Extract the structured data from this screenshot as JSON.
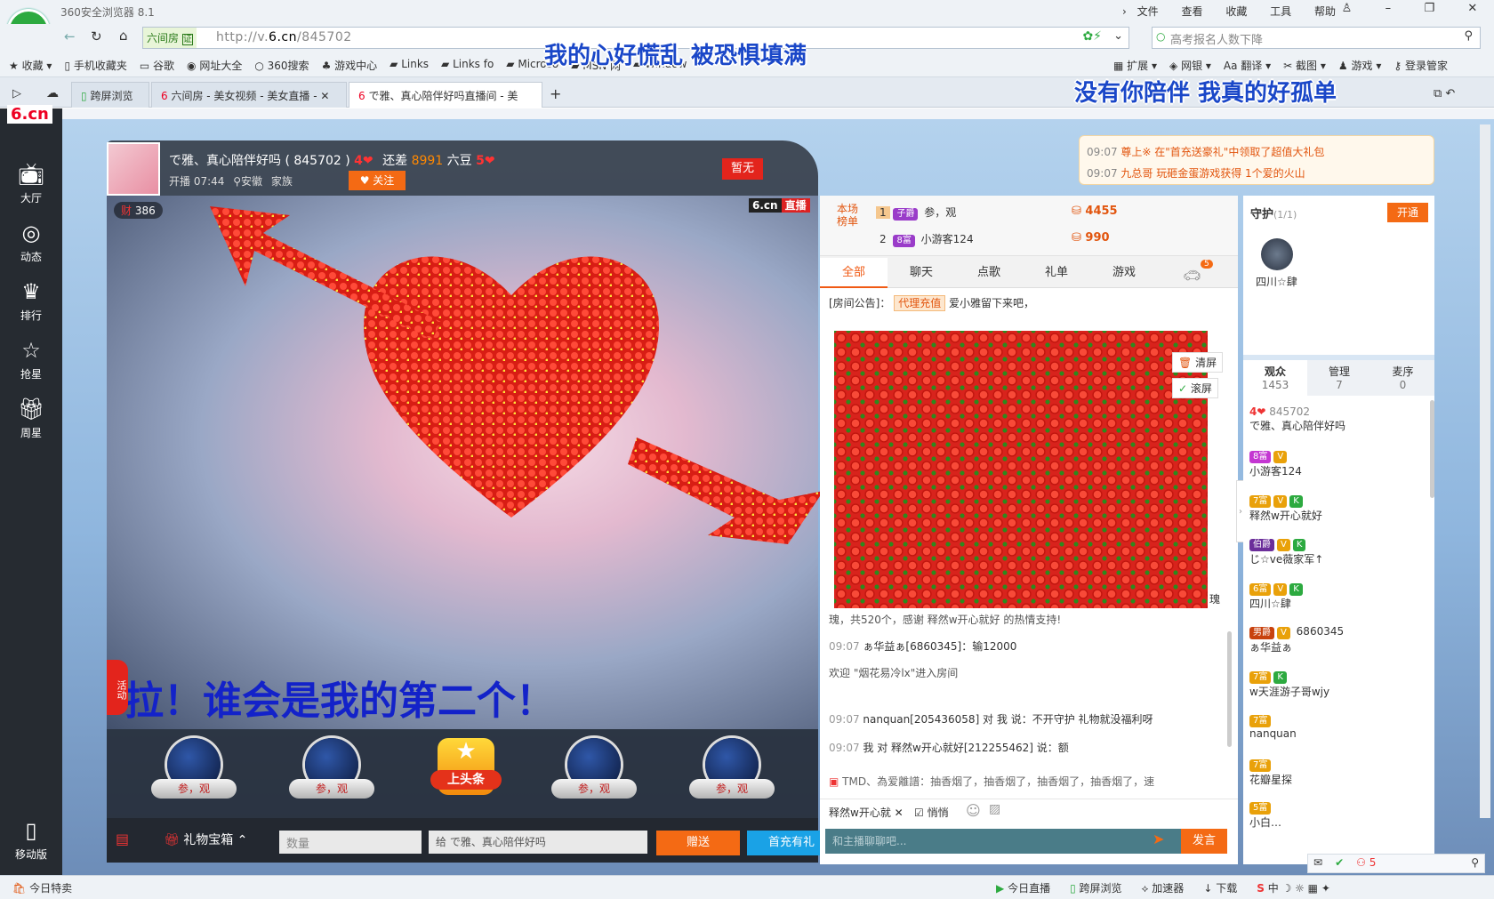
{
  "browser": {
    "title": "360安全浏览器 8.1",
    "menu": [
      "文件",
      "查看",
      "收藏",
      "工具",
      "帮助"
    ],
    "address_site": "六间房",
    "address_cert": "证",
    "url_prefix": "http://v.",
    "url_domain": "6.cn",
    "url_path": "/845702",
    "search_placeholder": "高考报名人数下降",
    "bookmarks": [
      "收藏",
      "手机收藏夹",
      "谷歌",
      "网址大全",
      "360搜索",
      "游戏中心",
      "Links",
      "Links fo",
      "Microso",
      "MSN 网",
      "Window"
    ],
    "tools": [
      "扩展",
      "网银",
      "翻译",
      "截图",
      "游戏",
      "登录管家"
    ],
    "tabs": [
      "跨屏浏览",
      "六间房 - 美女视频 - 美女直播 -",
      "で雅、真心陪伴好吗直播间 - 美"
    ]
  },
  "overlay": {
    "lyric1": "我的心好慌乱 被恐惧填满",
    "lyric2": "没有你陪伴 我真的好孤单",
    "video_caption": "拉！谁会是我的第二个！"
  },
  "sidebar": {
    "items": [
      "大厅",
      "动态",
      "排行",
      "抢星",
      "周星"
    ],
    "mobile": "移动版"
  },
  "site": {
    "logo": "6.cn"
  },
  "anchor": {
    "name_line": "で雅、真心陪伴好吗 ( 845702 )",
    "level": "4",
    "need_label": "还差",
    "need_value": "8991",
    "need_unit": "六豆",
    "next_level": "5",
    "open_time": "开播 07:44",
    "location": "安徽",
    "family": "家族",
    "follow": "关注",
    "flag": "暂无",
    "wealth": "386",
    "live_brand": "6.cn",
    "live_tag": "直播",
    "activity": "活动"
  },
  "notices": [
    {
      "time": "09:07",
      "text": "尊上※ 在\"首充送豪礼\"中领取了超值大礼包"
    },
    {
      "time": "09:07",
      "text": "九总哥 玩砸金蛋游戏获得 1个爱的火山"
    }
  ],
  "ranking": {
    "label": "本场榜单",
    "rows": [
      {
        "rank": "1",
        "badge": "子爵",
        "name": "参，观",
        "score": "4455"
      },
      {
        "rank": "2",
        "badge": "8富",
        "name": "小游客124",
        "score": "990"
      }
    ]
  },
  "chat_tabs": [
    "全部",
    "聊天",
    "点歌",
    "礼单",
    "游戏"
  ],
  "chat_tab_badge": "5",
  "chat": {
    "announce_label": "[房间公告]：",
    "announce_tag": "代理充值",
    "announce_text": "爱小雅留下来吧，",
    "clear_btn": "清屏",
    "scroll_btn": "滚屏",
    "gift_tail": "瑰",
    "gift_line": "瑰，共520个，感谢 释然w开心就好 的热情支持!",
    "messages": [
      {
        "time": "09:07",
        "text": "ぁ华益ぁ[6860345]：输12000"
      },
      {
        "time": "",
        "text": "欢迎 \"烟花易冷lx\"进入房间"
      },
      {
        "time": "09:07",
        "text": "nanquan[205436058] 对 我 说：不开守护 礼物就没福利呀"
      },
      {
        "time": "09:07",
        "text": "我 对 释然w开心就好[212255462] 说：额"
      },
      {
        "time": "",
        "text": "TMD、為爱離譜：抽香烟了，抽香烟了，抽香烟了，抽香烟了，速"
      }
    ],
    "target_user": "释然w开心就",
    "whisper": "悄悄",
    "input_placeholder": "和主播聊聊吧...",
    "send": "发言"
  },
  "gift_bar": {
    "items": [
      "参，观",
      "参，观",
      "上头条",
      "参，观",
      "参，观"
    ],
    "gift_box": "礼物宝箱",
    "qty_placeholder": "数量",
    "to_label": "给",
    "to_name": "で雅、真心陪伴好吗",
    "give": "赠送",
    "first_recharge": "首充有礼"
  },
  "guard": {
    "title": "守护",
    "count": "(1/1)",
    "open": "开通",
    "member": "四川☆肆"
  },
  "users": {
    "tabs": [
      {
        "label": "观众",
        "count": "1453"
      },
      {
        "label": "管理",
        "count": "7"
      },
      {
        "label": "麦序",
        "count": "0"
      }
    ],
    "list": [
      {
        "badge": "4",
        "id": "845702",
        "name": "で雅、真心陪伴好吗"
      },
      {
        "badge": "8富",
        "id": "",
        "name": "小游客124"
      },
      {
        "badge": "7富",
        "id": "",
        "name": "释然w开心就好"
      },
      {
        "badge": "伯爵",
        "id": "",
        "name": "じ☆ve薇家军↑"
      },
      {
        "badge": "6富",
        "id": "",
        "name": "四川☆肆"
      },
      {
        "badge": "男爵",
        "id": "6860345",
        "name": "ぁ华益ぁ"
      },
      {
        "badge": "7富",
        "id": "",
        "name": "w天涯游子哥wjy"
      },
      {
        "badge": "7富",
        "id": "",
        "name": "nanquan"
      },
      {
        "badge": "7富",
        "id": "",
        "name": "花瓣星探"
      },
      {
        "badge": "5富",
        "id": "",
        "name": "小白…"
      }
    ]
  },
  "mini_status": {
    "people": "5"
  },
  "statusbar": {
    "left": "今日特卖",
    "items": [
      "今日直播",
      "跨屏浏览",
      "加速器",
      "下载"
    ],
    "ime": "中"
  },
  "colors": {
    "accent": "#f46a14",
    "brand_green": "#2daa40",
    "lyric_blue": "#1a47c8"
  }
}
